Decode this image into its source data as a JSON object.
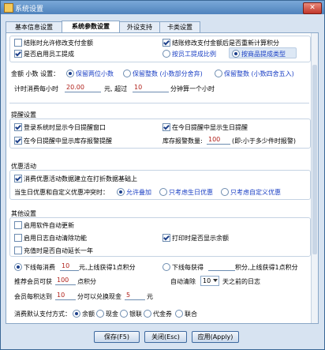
{
  "window": {
    "title": "系统设置"
  },
  "tabs": [
    {
      "label": "基本信息设置"
    },
    {
      "label": "系统参数设置"
    },
    {
      "label": "外设支持"
    },
    {
      "label": "卡类设置"
    }
  ],
  "top": {
    "cb1": "结账时允许修改支付金额",
    "cb2": "结账修改支付金额后是否重新计算积分",
    "cb3": "是否启用员工提成",
    "rb1": "按员工提成比例",
    "rb2": "按商品提成类型"
  },
  "amount": {
    "label": "金额  小数  设置：",
    "r1": "保留两位小数",
    "r2": "保留整数 (小数部分舍弃)",
    "r3": "保留整数 (小数四舍五入)",
    "tp1": "计时消费每小时",
    "v1": "20.00",
    "tp2": "元, 超过",
    "v2": "10",
    "tp3": "分钟算一个小时"
  },
  "remind": {
    "header": "提醒设置",
    "c1": "登录系统时显示今日提醒窗口",
    "c2": "在今日提醒中显示生日提醒",
    "c3": "在今日提醒中显示库存报警提醒",
    "stock_label": "库存报警数量:",
    "stock_value": "100",
    "stock_note": "(即:小于多少件时报警)"
  },
  "promo": {
    "header": "优惠活动",
    "c1": "消费优惠活动数据建立在打折数据基础上",
    "conflict_label": "当生日优惠和自定义优惠冲突时：",
    "r1": "允许叠加",
    "r2": "只考虑生日优惠",
    "r3": "只考虑自定义优惠"
  },
  "other": {
    "header": "其他设置",
    "c1": "启用软件自动更新",
    "c2": "启用日志自动清除功能",
    "c3": "打印时是否显示余额",
    "c4": "充值时是否自动延长一年",
    "r1a": "下线每消费",
    "r1v": "10",
    "r1b": "元,上线获得1点积分",
    "r2a": "下线每获得",
    "r2v": "",
    "r2b": "积分,上线获得1点积分",
    "ref_label": "推荐会员可获",
    "ref_value": "100",
    "ref_unit": "点积分",
    "auto_label": "自动清除",
    "auto_value": "10",
    "auto_unit": "天之前的日志",
    "ex_a": "会员每积达到",
    "ex_v1": "10",
    "ex_b": "分可以兑换现金",
    "ex_v2": "5",
    "ex_c": "元"
  },
  "pay": {
    "label": "消费默认支付方式：",
    "o1": "余额",
    "o2": "现金",
    "o3": "银联",
    "o4": "代金券",
    "o5": "联合"
  },
  "buttons": {
    "save": "保存(F5)",
    "close": "关闭(Esc)",
    "apply": "应用(Apply)"
  }
}
